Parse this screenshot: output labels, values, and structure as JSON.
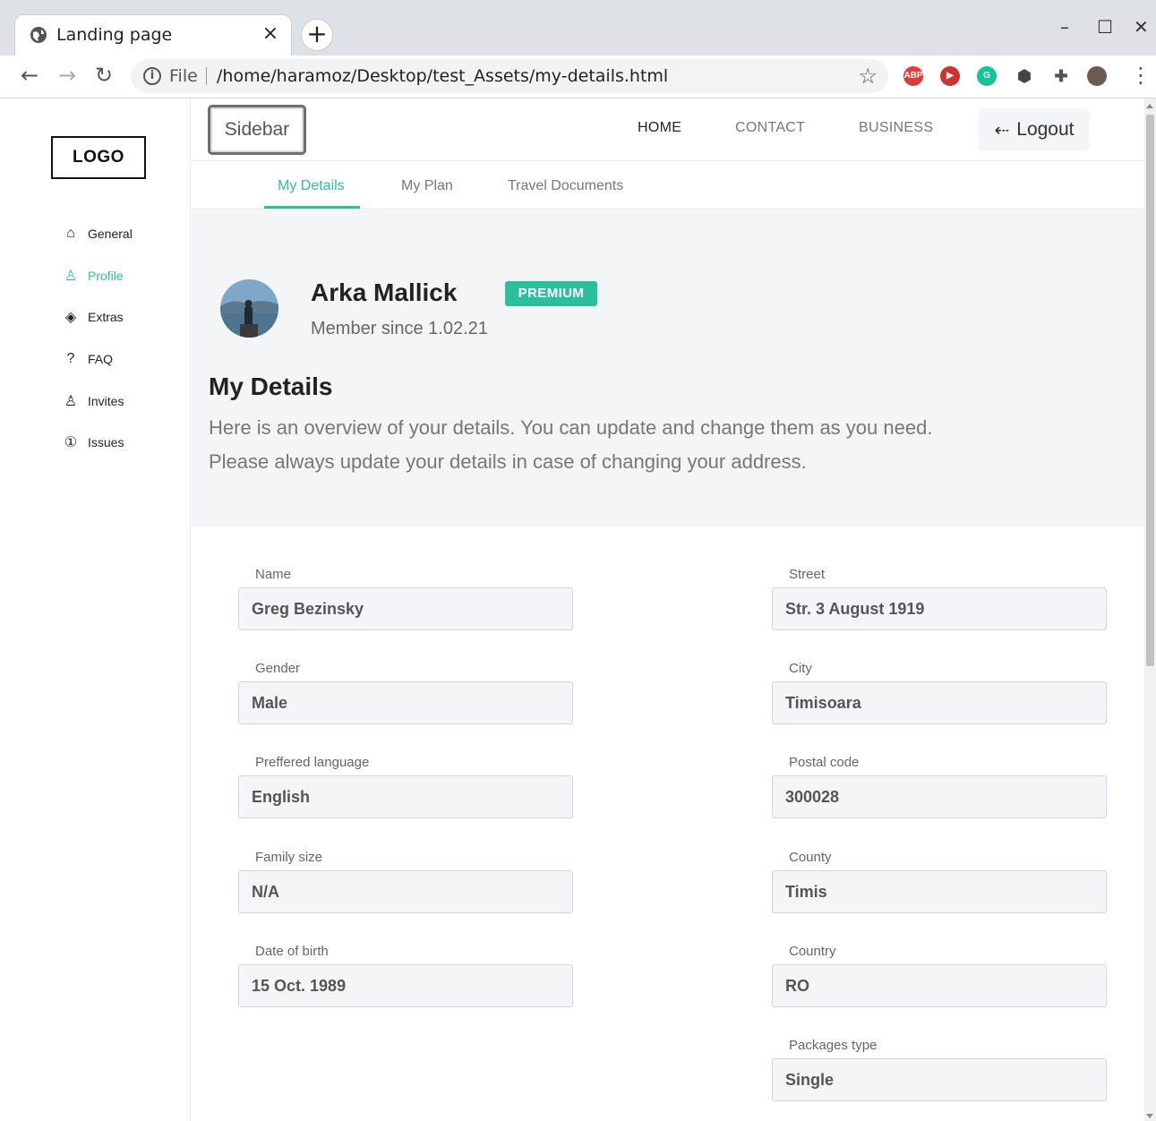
{
  "browser": {
    "tab_title": "Landing page",
    "tab_close": "×",
    "new_tab": "+",
    "minimize": "–",
    "maximize": "☐",
    "close": "✕",
    "file_label": "File",
    "url": "/home/haramoz/Desktop/test_Assets/my-details.html",
    "extensions": [
      {
        "name": "adblock-plus-icon",
        "label": "ABP",
        "color": "#e53935"
      },
      {
        "name": "video-extension-icon",
        "label": "▶",
        "color": "#d32f2f"
      },
      {
        "name": "grammarly-icon",
        "label": "G",
        "color": "#15c39a"
      },
      {
        "name": "cube-extension-icon",
        "label": "",
        "color": "#444444"
      },
      {
        "name": "puzzle-extensions-icon",
        "label": "",
        "color": "#555555"
      },
      {
        "name": "profile-avatar-icon",
        "label": "",
        "color": "#6d5b50"
      }
    ]
  },
  "sidebar": {
    "logo": "LOGO",
    "items": [
      {
        "label": "General",
        "icon": "home-icon",
        "glyph": "⌂"
      },
      {
        "label": "Profile",
        "icon": "user-icon",
        "glyph": "♙"
      },
      {
        "label": "Extras",
        "icon": "diamond-icon",
        "glyph": "◈"
      },
      {
        "label": "FAQ",
        "icon": "question-icon",
        "glyph": "?"
      },
      {
        "label": "Invites",
        "icon": "user-add-icon",
        "glyph": "♙"
      },
      {
        "label": "Issues",
        "icon": "info-circle-icon",
        "glyph": "①"
      }
    ],
    "active_index": 1
  },
  "topbar": {
    "sidebar_button": "Sidebar",
    "nav": [
      "HOME",
      "CONTACT",
      "BUSINESS"
    ],
    "logout": "Logout"
  },
  "subtabs": [
    "My Details",
    "My Plan",
    "Travel Documents"
  ],
  "profile": {
    "name": "Arka Mallick",
    "badge": "PREMIUM",
    "member_since": "Member since 1.02.21"
  },
  "details": {
    "title": "My Details",
    "description_line1": "Here is an overview of your details. You can update and change them as you need.",
    "description_line2": "Please always update your details in case of changing your address."
  },
  "left_fields": [
    {
      "label": "Name",
      "value": "Greg Bezinsky"
    },
    {
      "label": "Gender",
      "value": "Male"
    },
    {
      "label": "Preffered language",
      "value": "English"
    },
    {
      "label": "Family size",
      "value": "N/A"
    },
    {
      "label": "Date of birth",
      "value": "15 Oct. 1989"
    }
  ],
  "right_fields": [
    {
      "label": "Street",
      "value": "Str. 3 August 1919"
    },
    {
      "label": "City",
      "value": "Timisoara"
    },
    {
      "label": "Postal code",
      "value": "300028"
    },
    {
      "label": "County",
      "value": "Timis"
    },
    {
      "label": "Country",
      "value": "RO"
    },
    {
      "label": "Packages type",
      "value": "Single"
    }
  ],
  "colors": {
    "accent": "#2bbf9d",
    "hero_bg": "#f3f5f7"
  }
}
